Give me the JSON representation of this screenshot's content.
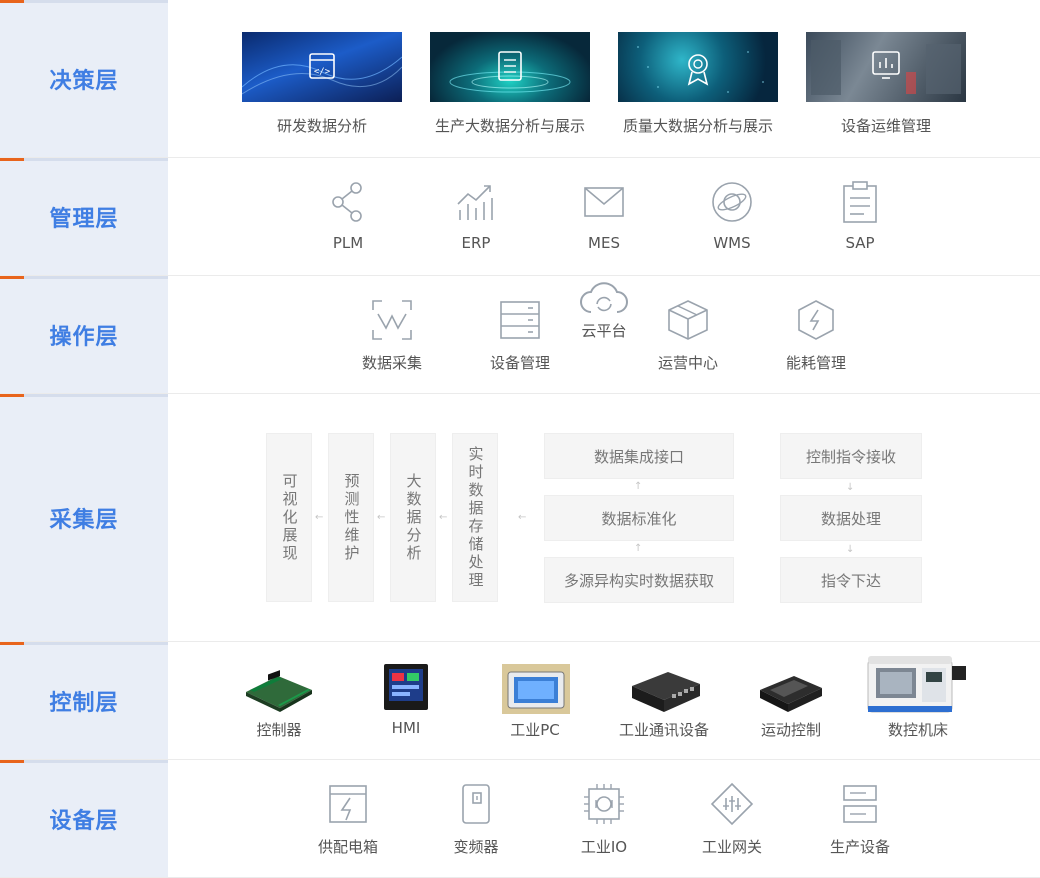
{
  "layers": {
    "decision": "决策层",
    "management": "管理层",
    "operation": "操作层",
    "collection": "采集层",
    "control": "控制层",
    "equipment": "设备层"
  },
  "decision_items": [
    "研发数据分析",
    "生产大数据分析与展示",
    "质量大数据分析与展示",
    "设备运维管理"
  ],
  "management_items": [
    "PLM",
    "ERP",
    "MES",
    "WMS",
    "SAP"
  ],
  "operation_items": [
    "数据采集",
    "设备管理",
    "云平台",
    "运营中心",
    "能耗管理"
  ],
  "collection": {
    "vertical": [
      "可视化展现",
      "预测性维护",
      "大数据分析",
      "实时数据存储处理"
    ],
    "middle": [
      "数据集成接口",
      "数据标准化",
      "多源异构实时数据获取"
    ],
    "right": [
      "控制指令接收",
      "数据处理",
      "指令下达"
    ]
  },
  "control_items": [
    "控制器",
    "HMI",
    "工业PC",
    "工业通讯设备",
    "运动控制",
    "数控机床"
  ],
  "equipment_items": [
    "供配电箱",
    "变频器",
    "工业IO",
    "工业网关",
    "生产设备"
  ],
  "colors": {
    "accent": "#3f7ee3",
    "marker": "#e8641c",
    "label_bg": "#e9eef7",
    "icon": "#9aa3ad"
  }
}
